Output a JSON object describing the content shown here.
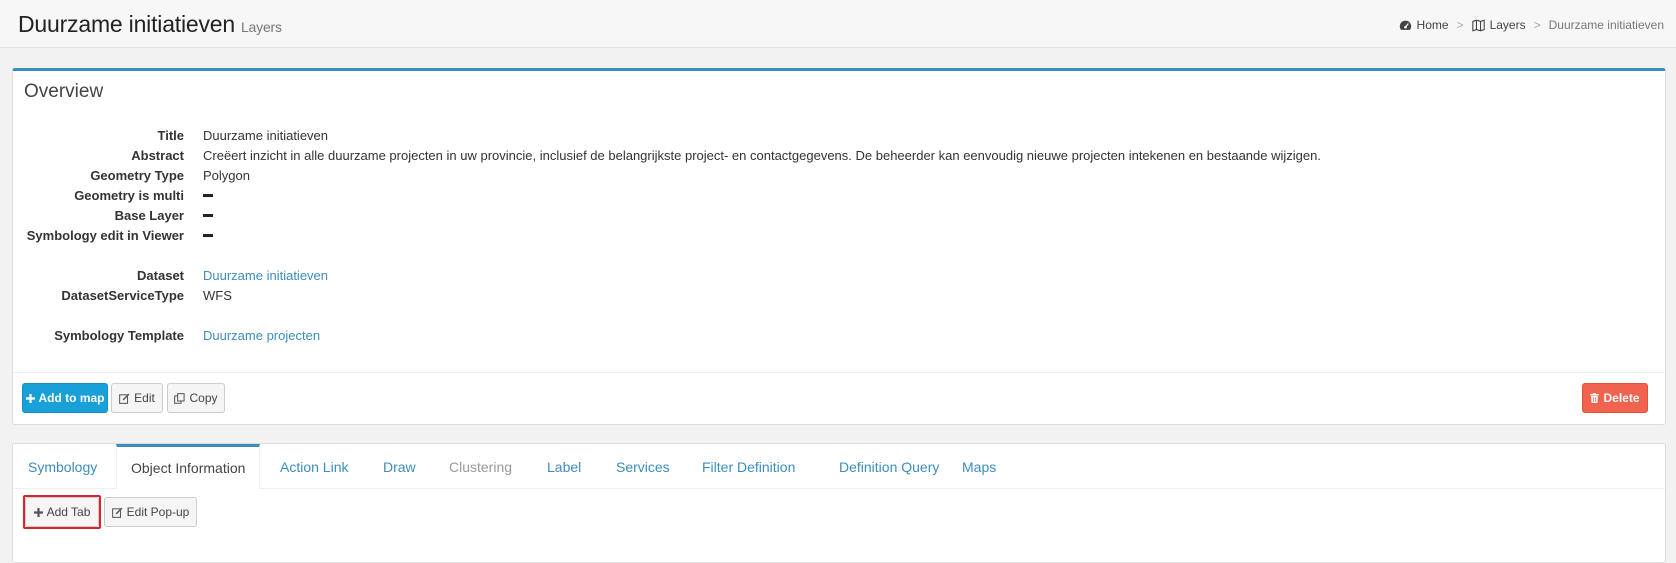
{
  "header": {
    "title": "Duurzame initiatieven",
    "subtitle": "Layers",
    "breadcrumb": [
      {
        "label": "Home",
        "icon": "dashboard-icon"
      },
      {
        "label": "Layers",
        "icon": "map-icon"
      },
      {
        "label": "Duurzame initiatieven"
      }
    ]
  },
  "overview": {
    "title": "Overview",
    "fields": [
      {
        "label": "Title",
        "value": "Duurzame initiatieven"
      },
      {
        "label": "Abstract",
        "value": "Creëert inzicht in alle duurzame projecten in uw provincie, inclusief de belangrijkste project- en contactgegevens. De beheerder kan eenvoudig nieuwe projecten intekenen en bestaande wijzigen."
      },
      {
        "label": "Geometry Type",
        "value": "Polygon"
      },
      {
        "label": "Geometry is multi",
        "value": ""
      },
      {
        "label": "Base Layer",
        "value": ""
      },
      {
        "label": "Symbology edit in Viewer",
        "value": ""
      },
      {
        "label": "Dataset",
        "value": "Duurzame initiatieven"
      },
      {
        "label": "DatasetServiceType",
        "value": "WFS"
      },
      {
        "label": "Symbology Template",
        "value": "Duurzame projecten"
      }
    ],
    "buttons": {
      "add_to_map": "Add to map",
      "edit": "Edit",
      "copy": "Copy",
      "delete": "Delete"
    }
  },
  "tabs": [
    {
      "label": "Symbology",
      "state": "normal"
    },
    {
      "label": "Object Information",
      "state": "active"
    },
    {
      "label": "Action Link",
      "state": "normal"
    },
    {
      "label": "Draw",
      "state": "normal"
    },
    {
      "label": "Clustering",
      "state": "disabled"
    },
    {
      "label": "Label",
      "state": "normal"
    },
    {
      "label": "Services",
      "state": "normal"
    },
    {
      "label": "Filter Definition",
      "state": "normal"
    },
    {
      "label": "Definition Query",
      "state": "normal"
    },
    {
      "label": "Maps",
      "state": "normal"
    }
  ],
  "tab_actions": {
    "add_tab": "Add Tab",
    "edit_popup": "Edit Pop-up"
  },
  "colors": {
    "accent": "#3c8dbc",
    "primary_button": "#1aa0d8",
    "danger_button": "#f0634e",
    "highlight": "#d9232d"
  }
}
